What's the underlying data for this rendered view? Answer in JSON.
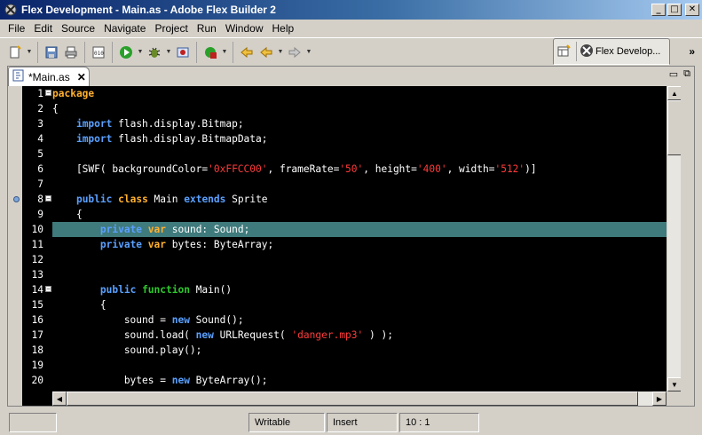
{
  "window": {
    "title": "Flex Development - Main.as - Adobe Flex Builder 2",
    "controls": {
      "minimize": "_",
      "maximize": "□",
      "close": "✕"
    }
  },
  "menu": [
    "File",
    "Edit",
    "Source",
    "Navigate",
    "Project",
    "Run",
    "Window",
    "Help"
  ],
  "toolbar": {
    "icons": [
      "new-icon",
      "save-icon",
      "print-icon",
      "binary-icon",
      "run-icon",
      "debug-icon",
      "export-icon",
      "external-tools-icon",
      "back-icon",
      "forward-icon"
    ],
    "perspective_label": "Flex Develop...",
    "more_label": "»"
  },
  "editor": {
    "tab_label": "*Main.as",
    "tab_close": "✕",
    "view_controls": {
      "minimize": "▭",
      "maximize": "⧉"
    },
    "lines": [
      {
        "num": "1",
        "fold": true,
        "tokens": [
          {
            "t": "package",
            "c": "kw2"
          }
        ]
      },
      {
        "num": "2",
        "tokens": [
          {
            "t": "{",
            "c": ""
          }
        ]
      },
      {
        "num": "3",
        "tokens": [
          {
            "t": "    ",
            "c": ""
          },
          {
            "t": "import",
            "c": "kw"
          },
          {
            "t": " flash.display.Bitmap;",
            "c": ""
          }
        ]
      },
      {
        "num": "4",
        "tokens": [
          {
            "t": "    ",
            "c": ""
          },
          {
            "t": "import",
            "c": "kw"
          },
          {
            "t": " flash.display.BitmapData;",
            "c": ""
          }
        ]
      },
      {
        "num": "5",
        "tokens": [
          {
            "t": "",
            "c": ""
          }
        ]
      },
      {
        "num": "6",
        "tokens": [
          {
            "t": "    [SWF( backgroundColor=",
            "c": ""
          },
          {
            "t": "'0xFFCC00'",
            "c": "str"
          },
          {
            "t": ", frameRate=",
            "c": ""
          },
          {
            "t": "'50'",
            "c": "str"
          },
          {
            "t": ", height=",
            "c": ""
          },
          {
            "t": "'400'",
            "c": "str"
          },
          {
            "t": ", width=",
            "c": ""
          },
          {
            "t": "'512'",
            "c": "str"
          },
          {
            "t": ")]",
            "c": ""
          }
        ]
      },
      {
        "num": "7",
        "tokens": [
          {
            "t": "",
            "c": ""
          }
        ]
      },
      {
        "num": "8",
        "fold": true,
        "bookmark": true,
        "tokens": [
          {
            "t": "    ",
            "c": ""
          },
          {
            "t": "public",
            "c": "kw"
          },
          {
            "t": " ",
            "c": ""
          },
          {
            "t": "class",
            "c": "kw2"
          },
          {
            "t": " Main ",
            "c": ""
          },
          {
            "t": "extends",
            "c": "kw"
          },
          {
            "t": " Sprite",
            "c": ""
          }
        ]
      },
      {
        "num": "9",
        "tokens": [
          {
            "t": "    {",
            "c": ""
          }
        ]
      },
      {
        "num": "10",
        "highlight": true,
        "tokens": [
          {
            "t": "        ",
            "c": ""
          },
          {
            "t": "private",
            "c": "kw"
          },
          {
            "t": " ",
            "c": ""
          },
          {
            "t": "var",
            "c": "kw2"
          },
          {
            "t": " sound: Sound;",
            "c": ""
          }
        ]
      },
      {
        "num": "11",
        "tokens": [
          {
            "t": "        ",
            "c": ""
          },
          {
            "t": "private",
            "c": "kw"
          },
          {
            "t": " ",
            "c": ""
          },
          {
            "t": "var",
            "c": "kw2"
          },
          {
            "t": " bytes: ByteArray;",
            "c": ""
          }
        ]
      },
      {
        "num": "12",
        "tokens": [
          {
            "t": "",
            "c": ""
          }
        ]
      },
      {
        "num": "13",
        "tokens": [
          {
            "t": "",
            "c": ""
          }
        ]
      },
      {
        "num": "14",
        "fold": true,
        "tokens": [
          {
            "t": "        ",
            "c": ""
          },
          {
            "t": "public",
            "c": "kw"
          },
          {
            "t": " ",
            "c": ""
          },
          {
            "t": "function",
            "c": "kwg"
          },
          {
            "t": " Main()",
            "c": ""
          }
        ]
      },
      {
        "num": "15",
        "tokens": [
          {
            "t": "        {",
            "c": ""
          }
        ]
      },
      {
        "num": "16",
        "tokens": [
          {
            "t": "            sound = ",
            "c": ""
          },
          {
            "t": "new",
            "c": "kw"
          },
          {
            "t": " Sound();",
            "c": ""
          }
        ]
      },
      {
        "num": "17",
        "tokens": [
          {
            "t": "            sound.load( ",
            "c": ""
          },
          {
            "t": "new",
            "c": "kw"
          },
          {
            "t": " URLRequest( ",
            "c": ""
          },
          {
            "t": "'danger.mp3'",
            "c": "str"
          },
          {
            "t": " ) );",
            "c": ""
          }
        ]
      },
      {
        "num": "18",
        "tokens": [
          {
            "t": "            sound.play();",
            "c": ""
          }
        ]
      },
      {
        "num": "19",
        "tokens": [
          {
            "t": "",
            "c": ""
          }
        ]
      },
      {
        "num": "20",
        "tokens": [
          {
            "t": "            bytes = ",
            "c": ""
          },
          {
            "t": "new",
            "c": "kw"
          },
          {
            "t": " ByteArray();",
            "c": ""
          }
        ]
      }
    ]
  },
  "colors": {
    "keyword_blue": "#5aa0ff",
    "keyword_orange": "#ffb030",
    "keyword_green": "#2ec82e",
    "string_red": "#ff3a3a",
    "current_line": "#3f7a7c"
  },
  "status": {
    "mode": "Writable",
    "insert": "Insert",
    "position": "10 : 1"
  }
}
